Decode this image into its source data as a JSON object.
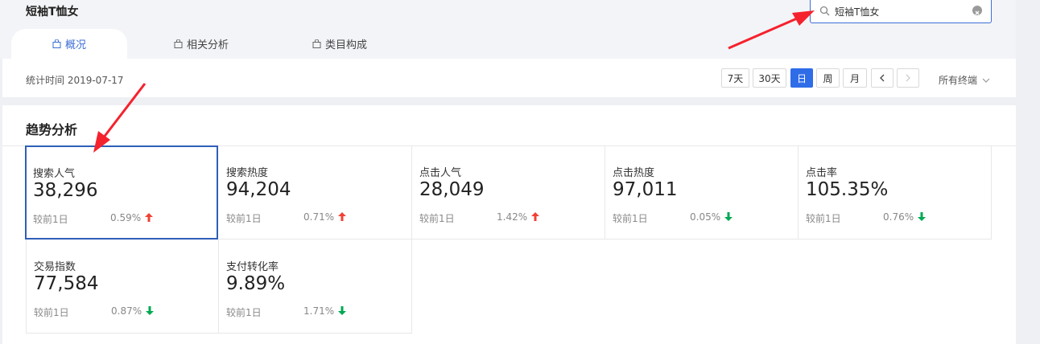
{
  "page": {
    "title": "短袖T恤女"
  },
  "search": {
    "value": "短袖T恤女"
  },
  "tabs": [
    {
      "label": "概况",
      "active": true
    },
    {
      "label": "相关分析",
      "active": false
    },
    {
      "label": "类目构成",
      "active": false
    }
  ],
  "stats_bar": {
    "time_label": "统计时间 2019-07-17",
    "period_buttons": [
      "7天",
      "30天",
      "日",
      "周",
      "月"
    ],
    "active_period": "日",
    "terminal_label": "所有终端"
  },
  "trend": {
    "title": "趋势分析",
    "compare_label": "较前1日",
    "cards": [
      {
        "label": "搜索人气",
        "value": "38,296",
        "change": "0.59%",
        "direction": "up",
        "selected": true
      },
      {
        "label": "搜索热度",
        "value": "94,204",
        "change": "0.71%",
        "direction": "up",
        "selected": false
      },
      {
        "label": "点击人气",
        "value": "28,049",
        "change": "1.42%",
        "direction": "up",
        "selected": false
      },
      {
        "label": "点击热度",
        "value": "97,011",
        "change": "0.05%",
        "direction": "down",
        "selected": false
      },
      {
        "label": "点击率",
        "value": "105.35%",
        "change": "0.76%",
        "direction": "down",
        "selected": false
      },
      {
        "label": "交易指数",
        "value": "77,584",
        "change": "0.87%",
        "direction": "down",
        "selected": false
      },
      {
        "label": "支付转化率",
        "value": "9.89%",
        "change": "1.71%",
        "direction": "down",
        "selected": false
      }
    ]
  },
  "colors": {
    "accent": "#2f6ce8",
    "up": "#f04134",
    "down": "#00a854",
    "annotation": "#f5222d"
  },
  "icons": [
    "search-icon",
    "clear-icon",
    "bag-icon",
    "chevron-left-icon",
    "chevron-right-icon",
    "chevron-down-icon",
    "arrow-up-icon",
    "arrow-down-icon"
  ]
}
